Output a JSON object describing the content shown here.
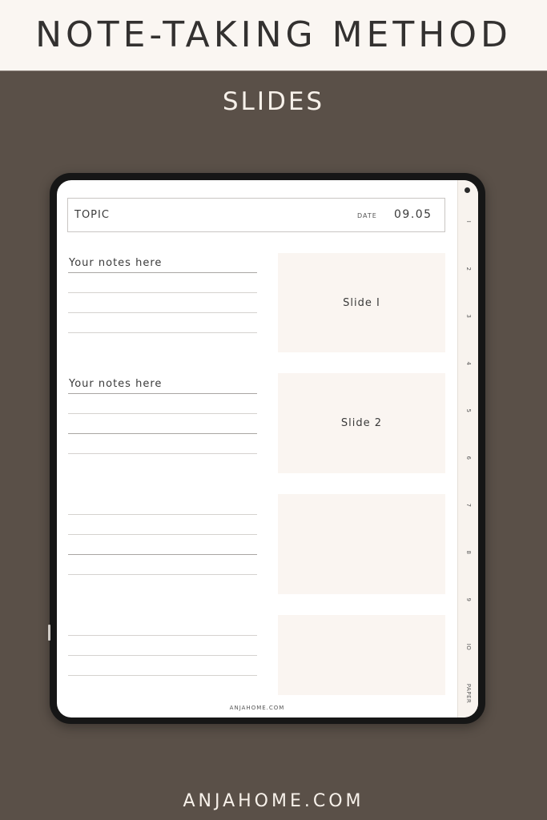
{
  "banner": {
    "title": "NOTE-TAKING METHOD"
  },
  "subtitle": "SLIDES",
  "page": {
    "topic_label": "TOPIC",
    "date_label": "DATE",
    "date_value": "09.05",
    "notes_sections": [
      {
        "heading": "Your notes here"
      },
      {
        "heading": "Your notes here"
      },
      {
        "heading": ""
      },
      {
        "heading": ""
      }
    ],
    "slides": [
      {
        "label": "Slide I"
      },
      {
        "label": "Slide 2"
      },
      {
        "label": ""
      },
      {
        "label": ""
      }
    ],
    "footer": "ANJAHOME.COM"
  },
  "tabs": [
    "I",
    "2",
    "3",
    "4",
    "5",
    "6",
    "7",
    "8",
    "9",
    "IO",
    "PAPER"
  ],
  "footer_brand": "ANJAHOME.COM",
  "colors": {
    "background": "#5a5048",
    "banner": "#faf6f2",
    "slide_fill": "#faf5f1",
    "text": "#333130"
  }
}
